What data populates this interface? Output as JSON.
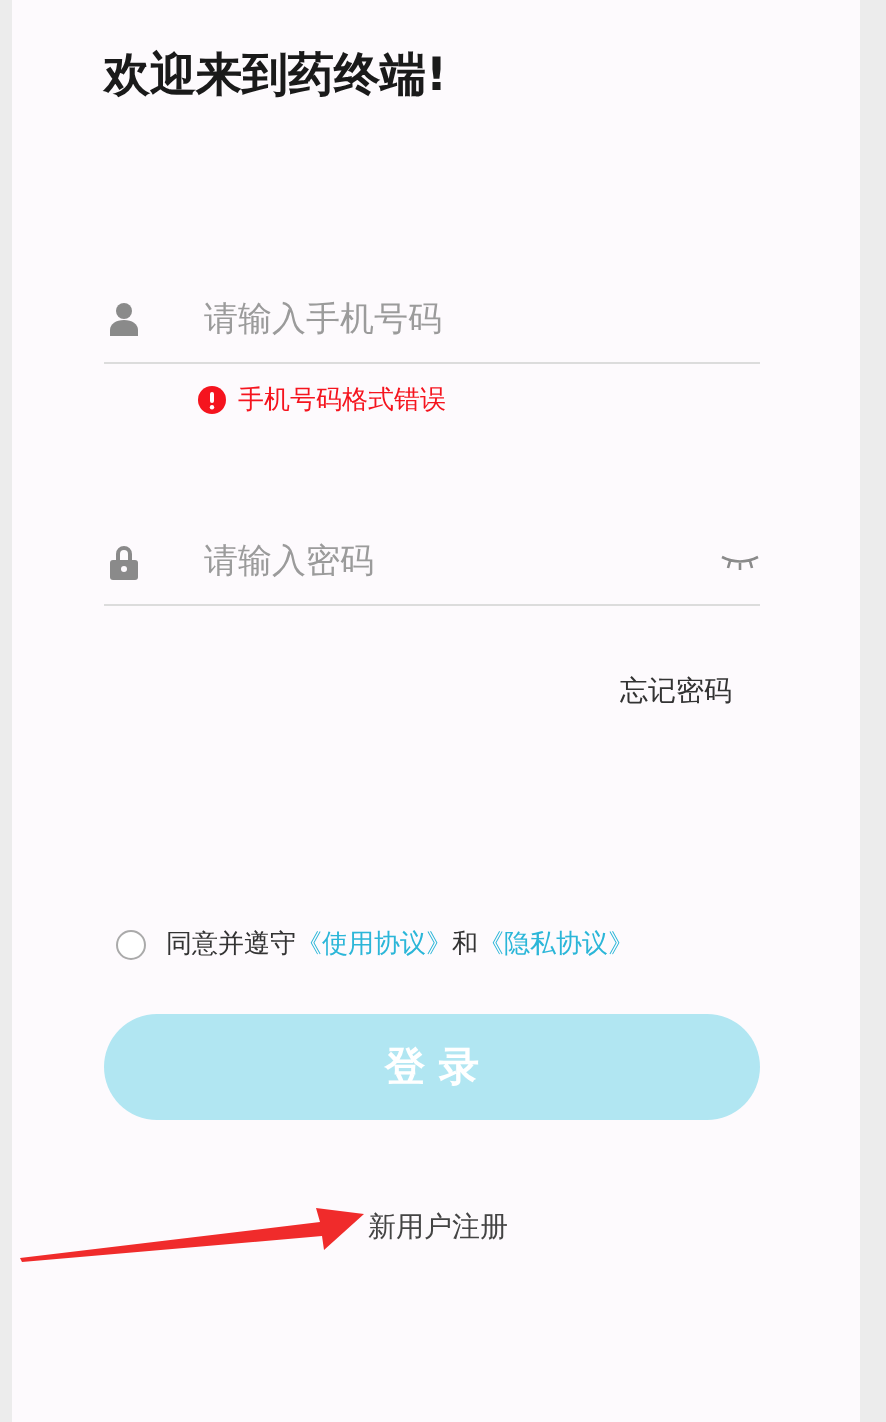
{
  "title": "欢迎来到药终端!",
  "phone_field": {
    "placeholder": "请输入手机号码",
    "error": "手机号码格式错误"
  },
  "password_field": {
    "placeholder": "请输入密码"
  },
  "forgot_password": "忘记密码",
  "agreement": {
    "checked": false,
    "prefix": "同意并遵守",
    "terms_link": "《使用协议》",
    "middle": "和",
    "privacy_link": "《隐私协议》"
  },
  "login_button": {
    "label": "登 录",
    "disabled": true
  },
  "register_link": "新用户注册"
}
